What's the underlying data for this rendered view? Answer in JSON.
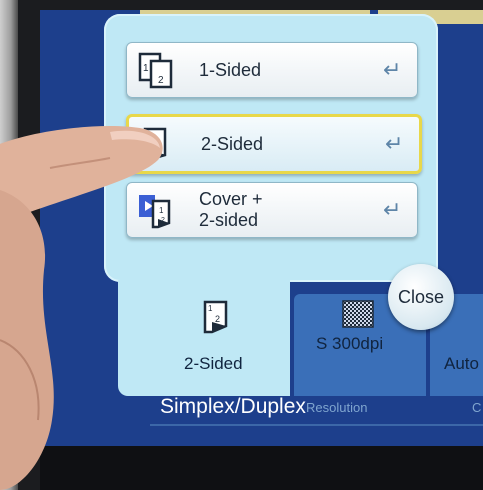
{
  "popup": {
    "options": [
      {
        "label": "1-Sided",
        "icon": "one-sided-icon",
        "selected": false
      },
      {
        "label": "2-Sided",
        "icon": "two-sided-icon",
        "selected": true
      },
      {
        "label": "Cover +\n2-sided",
        "icon": "cover-two-sided-icon",
        "selected": false
      }
    ],
    "close_label": "Close"
  },
  "tabs": {
    "simplex": {
      "label": "2-Sided",
      "icon": "two-sided-icon"
    },
    "resolution": {
      "label": "S 300dpi",
      "icon": "checker-pattern-icon"
    },
    "auto": {
      "label": "Auto"
    }
  },
  "section_title": "Simplex/Duplex",
  "sub_labels": {
    "resolution": "Resolution",
    "c": "C"
  },
  "colors": {
    "panel": "#bfe8f5",
    "screen": "#1d3f8c",
    "selected_border": "#e8d84a",
    "tab": "#3a6fb8"
  }
}
